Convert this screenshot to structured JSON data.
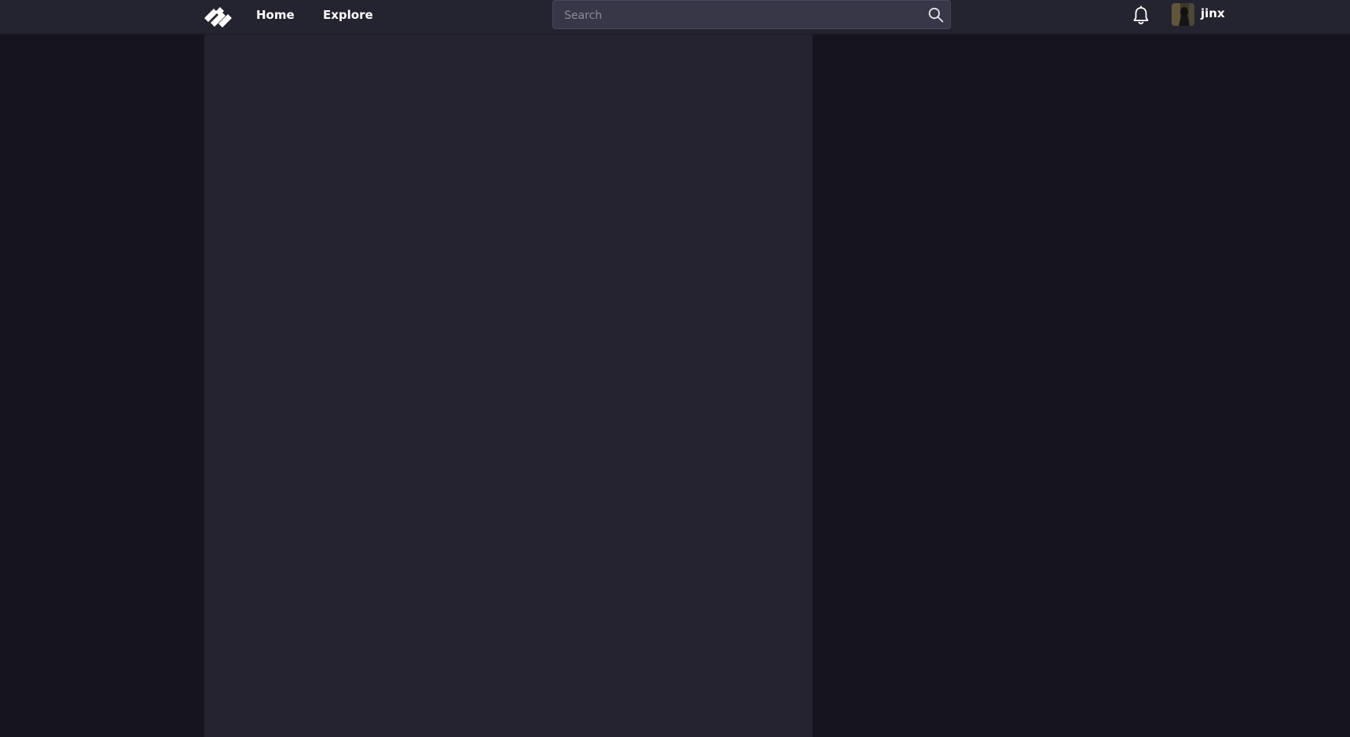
{
  "nav": {
    "logo_icon": "diagonal-stripes-logo-icon",
    "home_label": "Home",
    "explore_label": "Explore"
  },
  "search": {
    "placeholder": "Search",
    "icon": "search-icon"
  },
  "user": {
    "notifications_icon": "bell-icon",
    "username": "jinx"
  },
  "colors": {
    "background": "#16151f",
    "topbar": "#242330",
    "panel": "#24232f",
    "search_bg": "#383748",
    "text": "#ffffff"
  }
}
